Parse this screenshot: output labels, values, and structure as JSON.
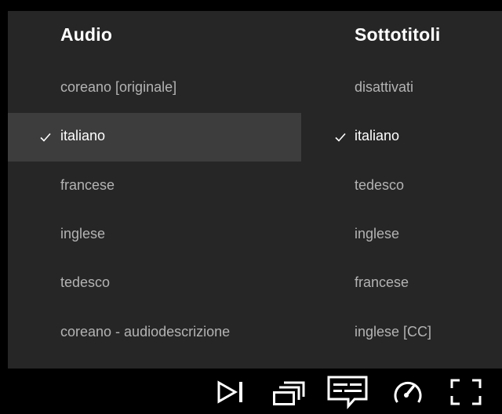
{
  "audio": {
    "title": "Audio",
    "options": [
      {
        "label": "coreano [originale]",
        "selected": false
      },
      {
        "label": "italiano",
        "selected": true
      },
      {
        "label": "francese",
        "selected": false
      },
      {
        "label": "inglese",
        "selected": false
      },
      {
        "label": "tedesco",
        "selected": false
      },
      {
        "label": "coreano - audiodescrizione",
        "selected": false
      }
    ]
  },
  "subtitles": {
    "title": "Sottotitoli",
    "options": [
      {
        "label": "disattivati",
        "selected": false
      },
      {
        "label": "italiano",
        "selected": true
      },
      {
        "label": "tedesco",
        "selected": false
      },
      {
        "label": "inglese",
        "selected": false
      },
      {
        "label": "francese",
        "selected": false
      },
      {
        "label": "inglese [CC]",
        "selected": false
      }
    ]
  },
  "controls": {
    "icons": [
      "next-episode-icon",
      "episodes-icon",
      "audio-subtitles-icon",
      "playback-speed-icon",
      "fullscreen-icon"
    ]
  },
  "colors": {
    "panel_bg": "#262626",
    "highlight_bg": "#3d3d3d",
    "selected_text": "#ffffff",
    "option_text": "#b3b3b3",
    "controls_bg": "#000000"
  }
}
